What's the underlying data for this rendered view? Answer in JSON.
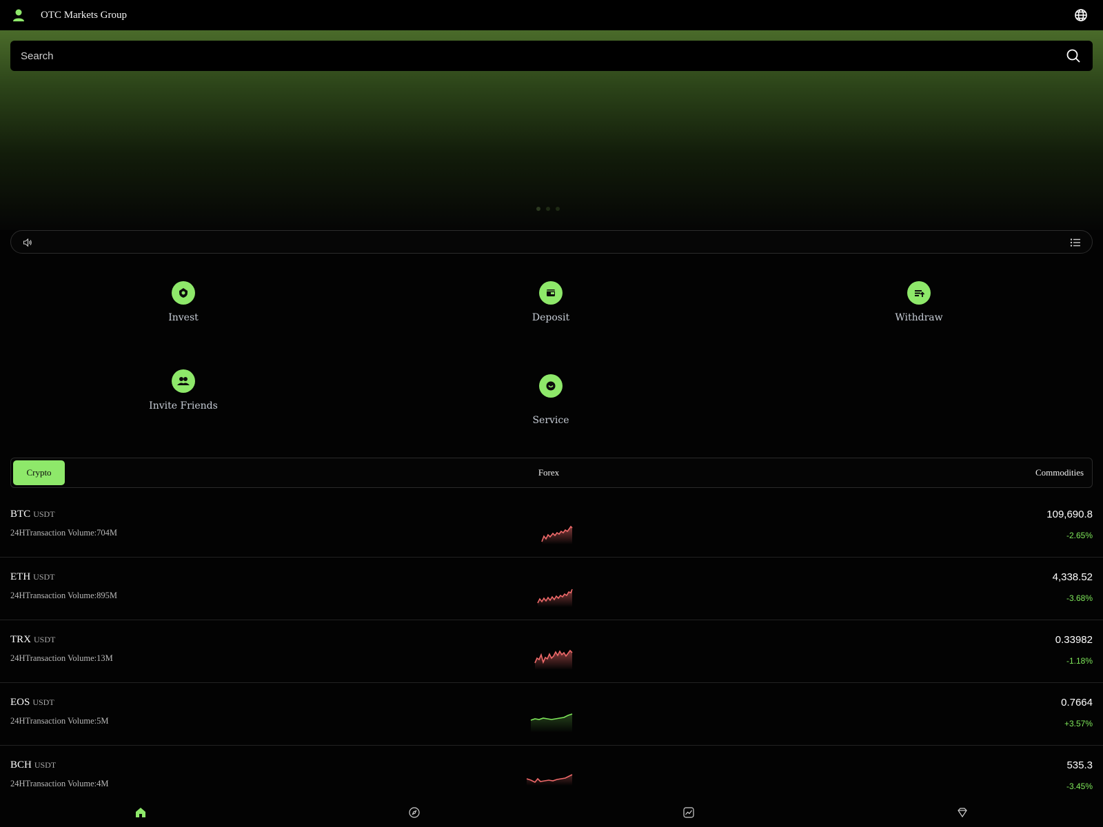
{
  "header": {
    "title": "OTC Markets Group",
    "user_icon": "user-icon",
    "language_icon": "globe-icon"
  },
  "search": {
    "placeholder": "Search",
    "icon": "search-icon"
  },
  "banner": {
    "slides": 3,
    "active_slide": 0
  },
  "notice": {
    "speaker_icon": "speaker-icon",
    "list_icon": "list-icon",
    "text": ""
  },
  "actions": [
    {
      "label": "Invest",
      "icon": "invest-icon"
    },
    {
      "label": "Deposit",
      "icon": "wallet-icon"
    },
    {
      "label": "Withdraw",
      "icon": "withdraw-icon"
    },
    {
      "label": "Invite Friends",
      "icon": "friends-icon"
    },
    {
      "label": "Service",
      "icon": "support-icon"
    }
  ],
  "tabs": [
    {
      "label": "Crypto",
      "active": true
    },
    {
      "label": "Forex",
      "active": false
    },
    {
      "label": "Commodities",
      "active": false
    }
  ],
  "markets": [
    {
      "base": "BTC",
      "quote": "USDT",
      "volume": "24HTransaction Volume:704M",
      "price": "109,690.8",
      "change": "-2.65%",
      "trend": "down"
    },
    {
      "base": "ETH",
      "quote": "USDT",
      "volume": "24HTransaction Volume:895M",
      "price": "4,338.52",
      "change": "-3.68%",
      "trend": "down"
    },
    {
      "base": "TRX",
      "quote": "USDT",
      "volume": "24HTransaction Volume:13M",
      "price": "0.33982",
      "change": "-1.18%",
      "trend": "down"
    },
    {
      "base": "EOS",
      "quote": "USDT",
      "volume": "24HTransaction Volume:5M",
      "price": "0.7664",
      "change": "+3.57%",
      "trend": "up"
    },
    {
      "base": "BCH",
      "quote": "USDT",
      "volume": "24HTransaction Volume:4M",
      "price": "535.3",
      "change": "-3.45%",
      "trend": "down"
    }
  ],
  "bottom_nav": [
    {
      "icon": "home-icon",
      "active": true
    },
    {
      "icon": "compass-icon",
      "active": false
    },
    {
      "icon": "chart-icon",
      "active": false
    },
    {
      "icon": "diamond-icon",
      "active": false
    }
  ],
  "colors": {
    "accent": "#8ee86a",
    "up": "#7fe85a",
    "down_line": "#f06a6a",
    "background": "#030303"
  }
}
